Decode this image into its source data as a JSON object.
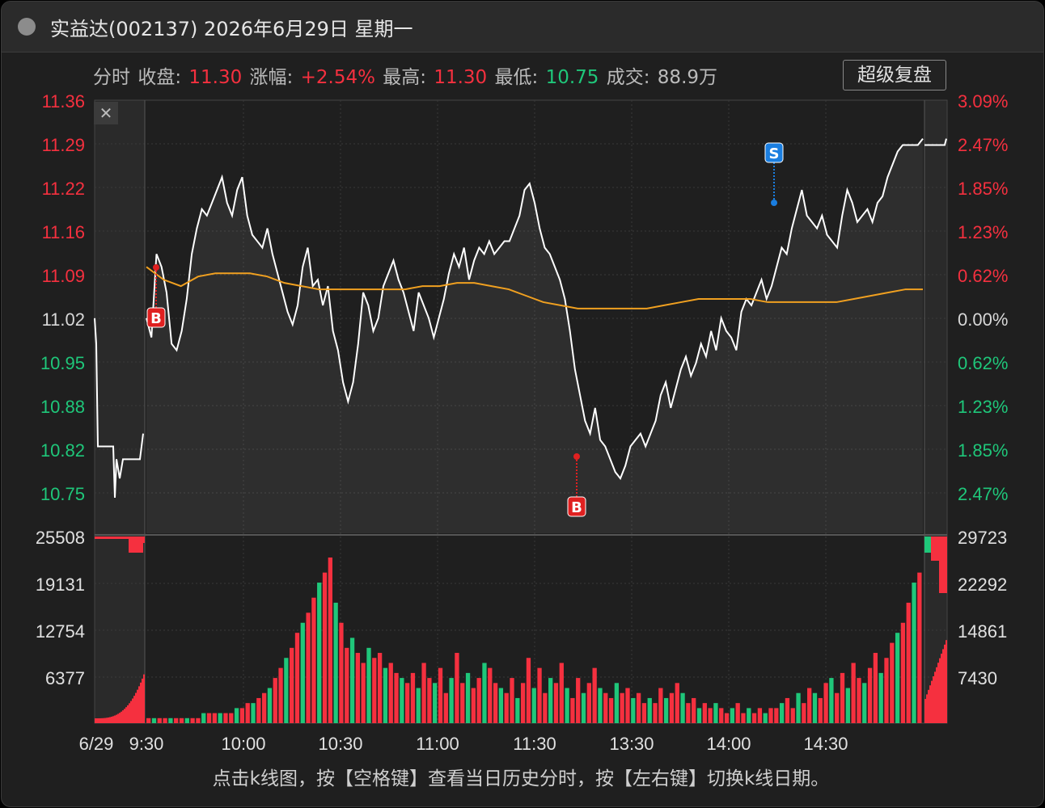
{
  "window": {
    "title": "实益达(002137) 2026年6月29日 星期一"
  },
  "info": {
    "mode": "分时",
    "close_label": "收盘:",
    "close_value": "11.30",
    "change_label": "涨幅:",
    "change_value": "+2.54%",
    "high_label": "最高:",
    "high_value": "11.30",
    "low_label": "最低:",
    "low_value": "10.75",
    "volume_label": "成交:",
    "volume_value": "88.9万"
  },
  "buttons": {
    "super_replay": "超级复盘",
    "close_x": "✕"
  },
  "footer": {
    "hint": "点击k线图，按【空格键】查看当日历史分时，按【左右键】切换k线日期。"
  },
  "colors": {
    "up": "#f5303f",
    "down": "#1fc77a",
    "price_line": "#ffffff",
    "avg_line": "#f0a020",
    "buy_marker": "#e02020",
    "sell_marker": "#1a7ee0"
  },
  "chart_data": {
    "type": "line",
    "price_axis_left": [
      "11.36",
      "11.29",
      "11.22",
      "11.16",
      "11.09",
      "11.02",
      "10.95",
      "10.88",
      "10.82",
      "10.75"
    ],
    "price_axis_right": [
      "3.09%",
      "2.47%",
      "1.85%",
      "1.23%",
      "0.62%",
      "0.00%",
      "0.62%",
      "1.23%",
      "1.85%",
      "2.47%"
    ],
    "volume_axis_left": [
      "25508",
      "19131",
      "12754",
      "6377"
    ],
    "volume_axis_right": [
      "29723",
      "22292",
      "14861",
      "7430"
    ],
    "x_ticks": [
      "6/29",
      "9:30",
      "10:00",
      "10:30",
      "11:00",
      "11:30",
      "13:30",
      "14:00",
      "14:30"
    ],
    "ylim": [
      10.75,
      11.36
    ],
    "pre_close": 11.02,
    "series": [
      {
        "key": "price",
        "values": [
          11.02,
          10.99,
          11.12,
          11.1,
          11.06,
          10.98,
          10.97,
          11.0,
          11.05,
          11.12,
          11.16,
          11.19,
          11.18,
          11.2,
          11.22,
          11.24,
          11.2,
          11.18,
          11.22,
          11.24,
          11.18,
          11.15,
          11.14,
          11.13,
          11.16,
          11.12,
          11.09,
          11.06,
          11.03,
          11.01,
          11.04,
          11.1,
          11.13,
          11.07,
          11.08,
          11.04,
          11.07,
          11.0,
          10.97,
          10.92,
          10.89,
          10.92,
          10.98,
          11.06,
          11.04,
          11.0,
          11.02,
          11.07,
          11.09,
          11.11,
          11.08,
          11.06,
          11.03,
          11.0,
          11.06,
          11.04,
          11.02,
          10.99,
          11.02,
          11.05,
          11.09,
          11.12,
          11.1,
          11.13,
          11.08,
          11.11,
          11.13,
          11.12,
          11.14,
          11.12,
          11.13,
          11.14,
          11.14,
          11.16,
          11.18,
          11.22,
          11.23,
          11.2,
          11.16,
          11.13,
          11.12,
          11.1,
          11.08,
          11.05,
          11.0,
          10.94,
          10.9,
          10.86,
          10.84,
          10.88,
          10.83,
          10.82,
          10.8,
          10.78,
          10.77,
          10.79,
          10.82,
          10.83,
          10.84,
          10.82,
          10.84,
          10.86,
          10.9,
          10.92,
          10.88,
          10.91,
          10.94,
          10.96,
          10.93,
          10.95,
          10.98,
          10.96,
          11.0,
          10.97,
          11.02,
          11.0,
          10.99,
          10.97,
          11.03,
          11.05,
          11.04,
          11.06,
          11.08,
          11.05,
          11.07,
          11.1,
          11.13,
          11.12,
          11.16,
          11.19,
          11.22,
          11.18,
          11.17,
          11.16,
          11.18,
          11.15,
          11.14,
          11.13,
          11.18,
          11.22,
          11.2,
          11.17,
          11.18,
          11.19,
          11.17,
          11.2,
          11.21,
          11.24,
          11.26,
          11.28,
          11.29,
          11.29,
          11.29,
          11.29,
          11.3
        ]
      },
      {
        "key": "avg",
        "values": [
          11.1,
          11.08,
          11.07,
          11.085,
          11.09,
          11.09,
          11.09,
          11.085,
          11.075,
          11.07,
          11.065,
          11.065,
          11.065,
          11.065,
          11.065,
          11.065,
          11.07,
          11.07,
          11.075,
          11.075,
          11.07,
          11.065,
          11.055,
          11.045,
          11.04,
          11.035,
          11.035,
          11.035,
          11.035,
          11.035,
          11.04,
          11.045,
          11.05,
          11.05,
          11.05,
          11.05,
          11.045,
          11.045,
          11.045,
          11.045,
          11.045,
          11.05,
          11.055,
          11.06,
          11.065,
          11.065
        ]
      }
    ],
    "volumes": [
      1,
      1,
      1,
      1,
      1,
      1,
      1,
      1,
      1,
      1,
      2,
      2,
      2,
      2,
      2,
      2,
      3,
      3,
      4,
      4,
      5,
      6,
      7,
      9,
      11,
      13,
      15,
      18,
      20,
      22,
      25,
      28,
      30,
      33,
      24,
      20,
      15,
      17,
      14,
      12,
      15,
      13,
      14,
      11,
      12,
      10,
      9,
      8,
      10,
      7,
      12,
      9,
      8,
      11,
      6,
      9,
      14,
      8,
      10,
      7,
      9,
      12,
      11,
      8,
      7,
      6,
      9,
      5,
      8,
      13,
      7,
      11,
      6,
      9,
      8,
      12,
      7,
      5,
      9,
      6,
      8,
      11,
      7,
      6,
      5,
      8,
      6,
      7,
      5,
      6,
      4,
      5,
      4,
      7,
      5,
      6,
      8,
      6,
      4,
      5,
      3,
      4,
      3,
      4,
      3,
      2,
      3,
      4,
      2,
      3,
      2,
      3,
      2,
      3,
      3,
      4,
      5,
      3,
      6,
      4,
      7,
      6,
      5,
      8,
      9,
      6,
      10,
      7,
      12,
      9,
      8,
      11,
      14,
      10,
      13,
      16,
      18,
      20,
      24,
      28,
      30
    ]
  }
}
